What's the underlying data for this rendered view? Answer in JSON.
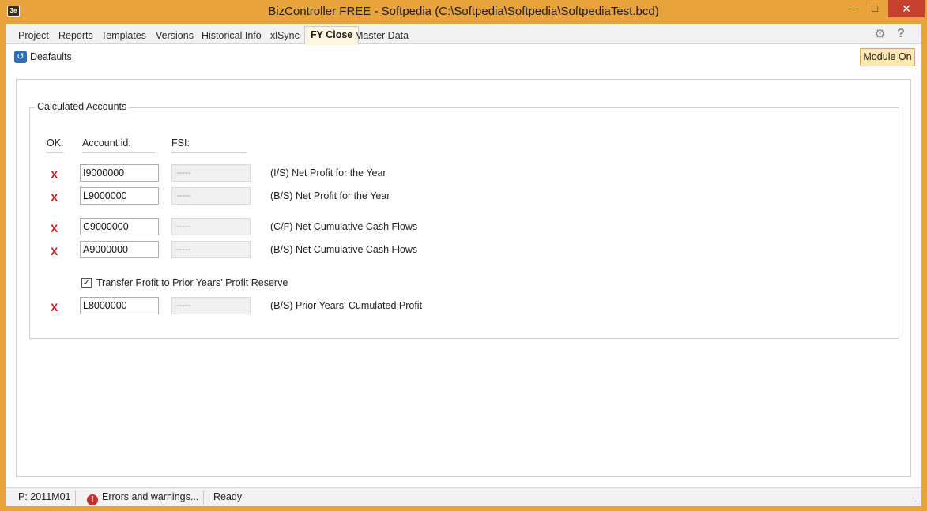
{
  "window": {
    "title": "BizController FREE - Softpedia (C:\\Softpedia\\Softpedia\\SoftpediaTest.bcd)",
    "icon_text": "3e"
  },
  "tabs": [
    {
      "label": "Project"
    },
    {
      "label": "Reports"
    },
    {
      "label": "Templates"
    },
    {
      "label": "Versions"
    },
    {
      "label": "Historical Info"
    },
    {
      "label": "xlSync"
    },
    {
      "label": "FY Close"
    },
    {
      "label": "Master Data"
    }
  ],
  "toolbar": {
    "defaults_label": "Deafaults",
    "module_label": "Module On"
  },
  "group": {
    "title": "Calculated Accounts",
    "col_ok": "OK:",
    "col_account": "Account id:",
    "col_fsi": "FSI:"
  },
  "rows": [
    {
      "ok": "X",
      "account": "I9000000",
      "fsi": "-----",
      "desc": "(I/S) Net Profit for the Year"
    },
    {
      "ok": "X",
      "account": "L9000000",
      "fsi": "-----",
      "desc": "(B/S) Net Profit for the Year"
    },
    {
      "ok": "X",
      "account": "C9000000",
      "fsi": "-----",
      "desc": "(C/F) Net Cumulative Cash Flows"
    },
    {
      "ok": "X",
      "account": "A9000000",
      "fsi": "-----",
      "desc": "(B/S) Net Cumulative Cash Flows"
    },
    {
      "ok": "X",
      "account": "L8000000",
      "fsi": "-----",
      "desc": "(B/S) Prior Years' Cumulated Profit"
    }
  ],
  "transfer": {
    "label": "Transfer Profit to Prior Years' Profit Reserve",
    "checked": true
  },
  "status": {
    "period": "P: 2011M01",
    "errors": "Errors and warnings...",
    "state": "Ready"
  },
  "colors": {
    "accent": "#e8a33d",
    "close_button": "#c7402d",
    "error_mark": "#d01818"
  },
  "icons": [
    "app-logo-icon",
    "minimize-icon",
    "maximize-icon",
    "close-icon",
    "gear-icon",
    "help-icon",
    "restore-defaults-icon",
    "error-icon",
    "check-icon"
  ]
}
